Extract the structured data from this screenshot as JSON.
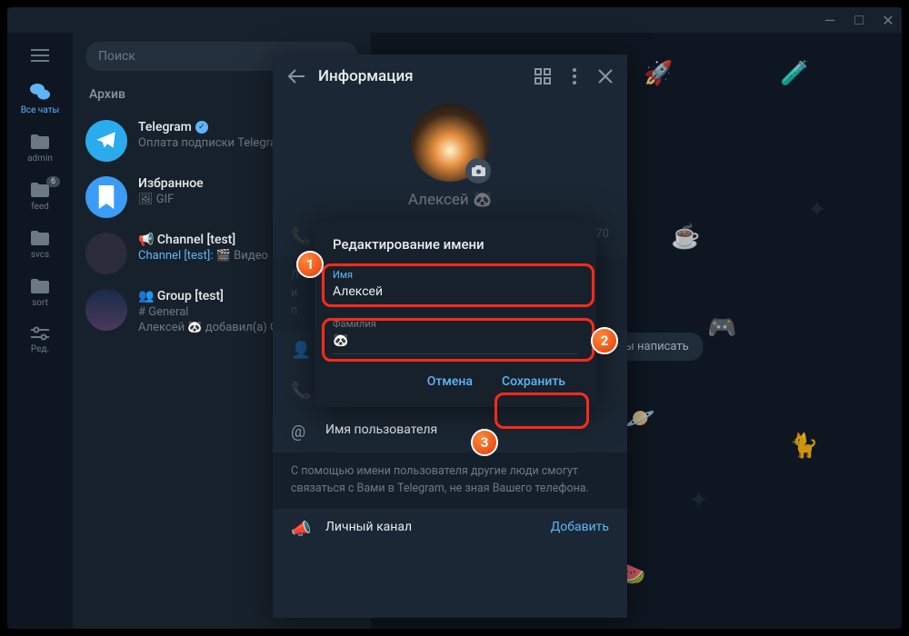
{
  "titlebar": {
    "min": "—",
    "max": "□",
    "close": "✕"
  },
  "rail": {
    "items": [
      {
        "name": "all-chats",
        "label": "Все чаты",
        "active": true
      },
      {
        "name": "admin",
        "label": "admin"
      },
      {
        "name": "feed",
        "label": "feed",
        "badge": "6"
      },
      {
        "name": "svcs",
        "label": "svcs"
      },
      {
        "name": "sort",
        "label": "sort"
      },
      {
        "name": "edit",
        "label": "Ред."
      }
    ]
  },
  "search": {
    "placeholder": "Поиск"
  },
  "archive": {
    "label": "Архив"
  },
  "chats": [
    {
      "title": "Telegram",
      "verified": true,
      "sub": "Оплата подписки Telegram"
    },
    {
      "title": "Избранное",
      "sub": "🖼 GIF"
    },
    {
      "title": "📢 Channel [test]",
      "sub_prefix": "Channel [test]:",
      "sub_rest": " 🎬 Видео"
    },
    {
      "title": "👥 Group [test]",
      "sub_line1": "# General",
      "sub_line2": "Алексей 🐼 добавил(а) С"
    }
  ],
  "empty_chat": {
    "text": "отели бы написать"
  },
  "info_panel": {
    "title": "Информация",
    "name": "Алексей 🐼",
    "phone_partial": "70",
    "bio_hint1": "Л",
    "bio_hint2": "и",
    "bio_hint3": "п",
    "emoji_suffix": "🐼",
    "username_label": "Имя пользователя",
    "username_hint": "С помощью имени пользователя другие люди смогут связаться с Вами в Telegram, не зная Вашего телефона.",
    "channel_label": "Личный канал",
    "channel_action": "Добавить"
  },
  "dialog": {
    "title": "Редактирование имени",
    "first_label": "Имя",
    "first_value": "Алексей",
    "last_label": "Фамилия",
    "last_value": "🐼",
    "cancel": "Отмена",
    "save": "Сохранить"
  },
  "annotations": {
    "n1": "1",
    "n2": "2",
    "n3": "3"
  }
}
